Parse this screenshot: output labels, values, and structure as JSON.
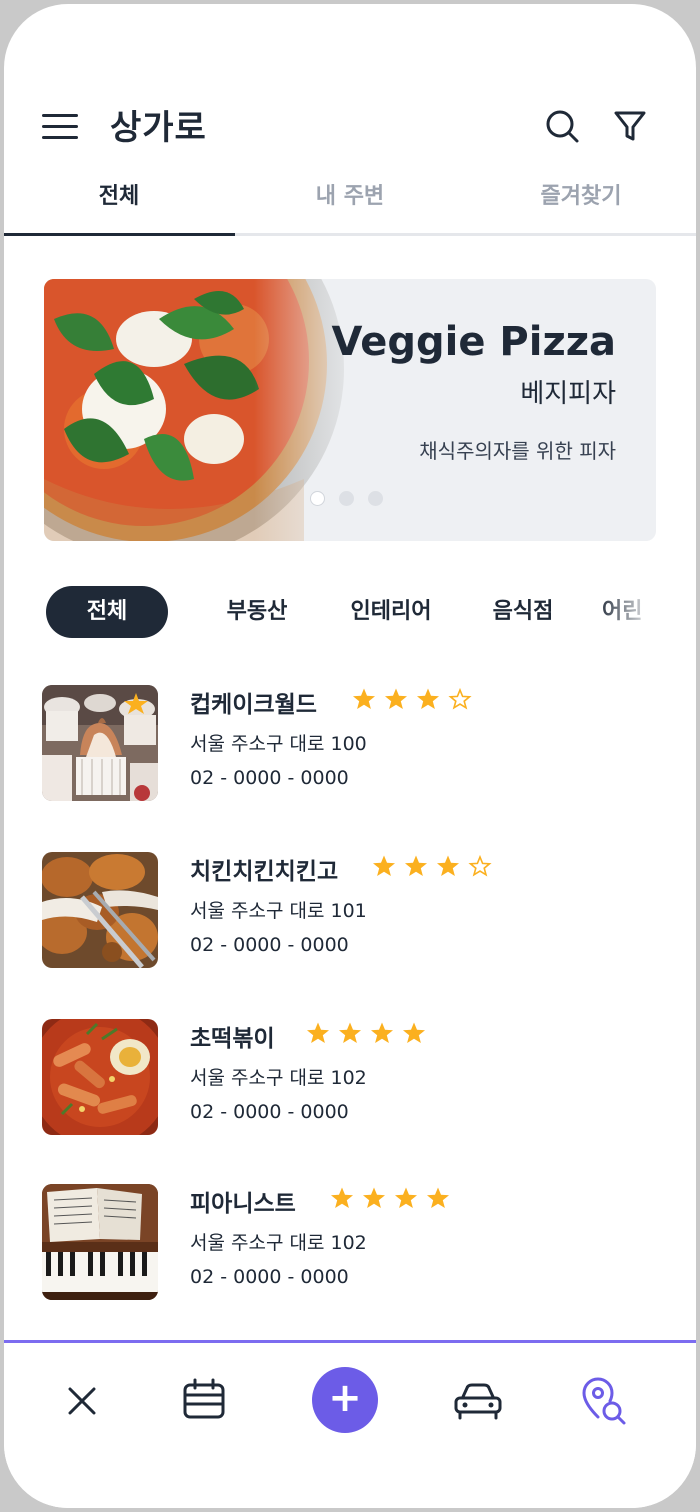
{
  "header": {
    "title": "상가로",
    "icons": {
      "menu": "menu-icon",
      "search": "search-icon",
      "filter": "filter-icon"
    }
  },
  "tabs": [
    {
      "label": "전체",
      "active": true
    },
    {
      "label": "내 주변",
      "active": false
    },
    {
      "label": "즐겨찾기",
      "active": false
    }
  ],
  "banner": {
    "title": "Veggie Pizza",
    "subtitle": "베지피자",
    "description": "채식주의자를 위한 피자",
    "slide_count": 3,
    "active_slide": 1
  },
  "categories": [
    {
      "label": "전체",
      "active": true
    },
    {
      "label": "부동산",
      "active": false
    },
    {
      "label": "인테리어",
      "active": false
    },
    {
      "label": "음식점",
      "active": false
    },
    {
      "label": "어린",
      "active": false
    }
  ],
  "shops": [
    {
      "name": "컵케이크월드",
      "rating": 3,
      "max_rating": 4,
      "address": "서울 주소구 대로 100",
      "phone": "02 - 0000 - 0000",
      "favorite": true,
      "image": "cupcake-photo"
    },
    {
      "name": "치킨치킨치킨고",
      "rating": 3,
      "max_rating": 4,
      "address": "서울 주소구 대로 101",
      "phone": "02 - 0000 - 0000",
      "favorite": false,
      "image": "fried-chicken-photo"
    },
    {
      "name": "초떡볶이",
      "rating": 4,
      "max_rating": 4,
      "address": "서울 주소구 대로 102",
      "phone": "02 - 0000 - 0000",
      "favorite": false,
      "image": "tteokbokki-photo"
    },
    {
      "name": "피아니스트",
      "rating": 4,
      "max_rating": 4,
      "address": "서울 주소구 대로 102",
      "phone": "02 - 0000 - 0000",
      "favorite": false,
      "image": "piano-photo"
    }
  ],
  "bottom_nav": {
    "items": [
      "close-icon",
      "calendar-icon",
      "add-icon",
      "car-icon",
      "location-search-icon"
    ],
    "fab_label": "+"
  },
  "colors": {
    "primary": "#6c5ce7",
    "dark": "#1f2937",
    "star": "#fbb01f",
    "muted": "#9ca3af"
  }
}
